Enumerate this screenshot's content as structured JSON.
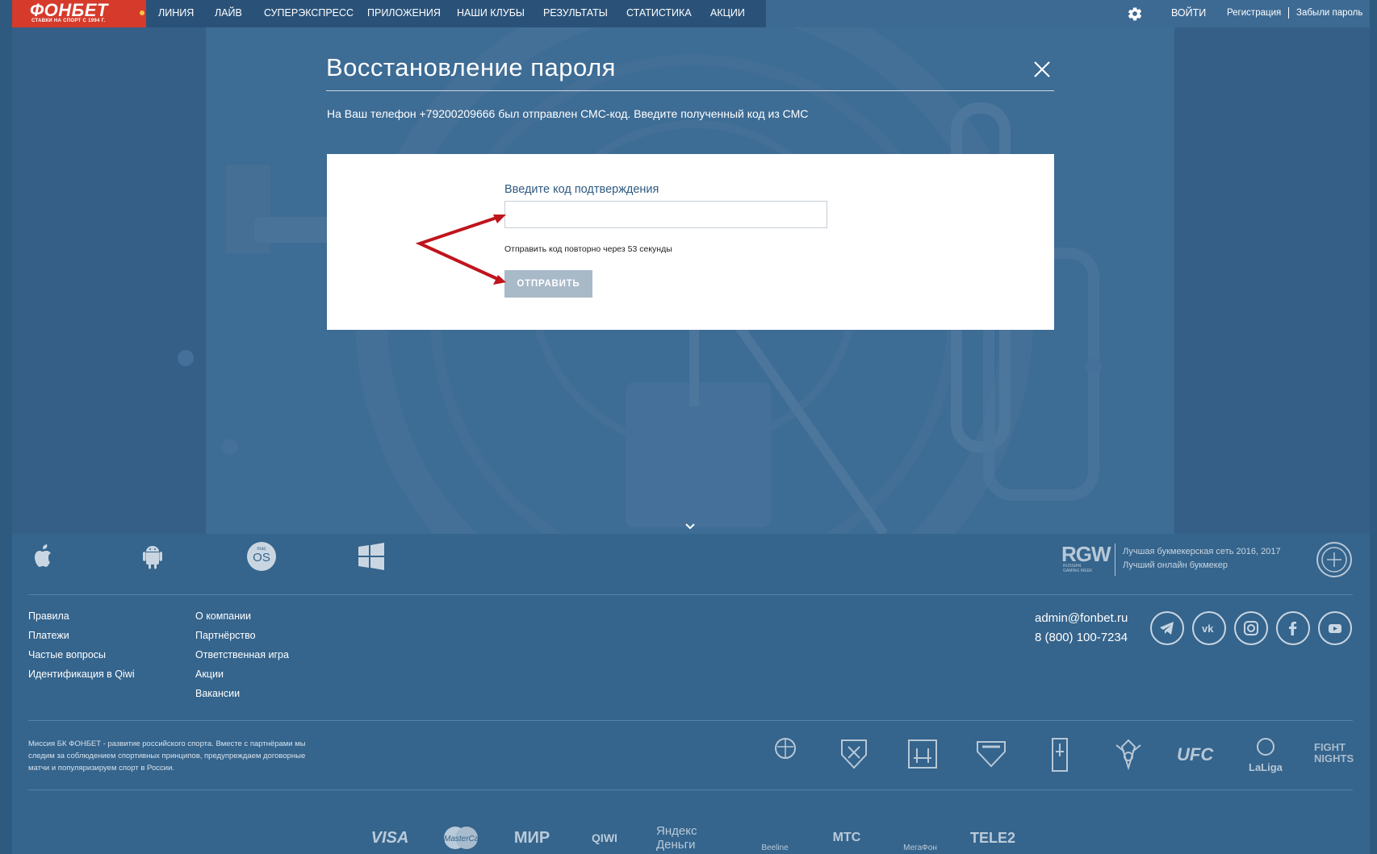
{
  "brand": {
    "name": "ФОНБЕТ",
    "tagline": "СТАВКИ НА СПОРТ С 1994 Г."
  },
  "nav": {
    "items": [
      "ЛИНИЯ",
      "ЛАЙВ",
      "СУПЕРЭКСПРЕСС",
      "ПРИЛОЖЕНИЯ",
      "НАШИ КЛУБЫ",
      "РЕЗУЛЬТАТЫ",
      "СТАТИСТИКА",
      "АКЦИИ"
    ],
    "login": "ВОЙТИ",
    "register": "Регистрация",
    "forgot": "Забыли пароль"
  },
  "dialog": {
    "title": "Восстановление пароля",
    "message": "На Ваш телефон +79200209666 был отправлен СМС-код. Введите полученный код из СМС",
    "field_label": "Введите код подтверждения",
    "code_value": "",
    "resend_text": "Отправить код повторно через 53 секунды",
    "submit_label": "ОТПРАВИТЬ"
  },
  "footer": {
    "apps": [
      "apple-icon",
      "android-icon",
      "macos-icon",
      "windows-icon"
    ],
    "macos_small": "mac",
    "macos_big": "OS",
    "rgw": {
      "logo": "RGW",
      "small": "RUSSIAN GAMING WEEK",
      "line1": "Лучшая букмекерская сеть 2016, 2017",
      "line2": "Лучший онлайн букмекер"
    },
    "links_col1": [
      "Правила",
      "Платежи",
      "Частые вопросы",
      "Идентификация в Qiwi"
    ],
    "links_col2": [
      "О компании",
      "Партнёрство",
      "Ответственная игра",
      "Акции",
      "Вакансии"
    ],
    "email": "admin@fonbet.ru",
    "phone": "8 (800) 100-7234",
    "social": [
      "telegram-icon",
      "vk-icon",
      "instagram-icon",
      "facebook-icon",
      "youtube-icon"
    ],
    "mission": "Миссия БК ФОНБЕТ - развитие российского спорта. Вместе с партнёрами мы следим за соблюдением спортивных принципов, предупреждаем договорные матчи и популяризируем спорт в России.",
    "sport_partners": [
      "Euroleague Basketball",
      "КХЛ",
      "ФОНБЕТ ФФ",
      "ФХР",
      "IIHF",
      "РФС",
      "UFC",
      "LaLiga",
      "FIGHT NIGHTS GLOBAL"
    ],
    "payments": [
      "VISA",
      "MasterCard",
      "МИР",
      "QIWI",
      "Яндекс Деньги",
      "Beeline",
      "МТС",
      "МегаФон",
      "TELE2"
    ]
  },
  "colors": {
    "brand_red": "#d63a2b",
    "page_blue": "#35648c",
    "nav_dark": "#2a5279",
    "button_disabled": "#a8b9c8",
    "arrow_red": "#c0141c"
  }
}
